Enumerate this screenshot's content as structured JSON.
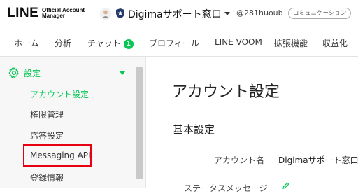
{
  "brand": {
    "logo": "LINE",
    "sub_line1": "Official Account",
    "sub_line2": "Manager"
  },
  "account": {
    "name": "Digimaサポート窓口",
    "id": "@281huoub",
    "plan_badge": "コミュニケーション"
  },
  "nav": [
    {
      "label": "ホーム"
    },
    {
      "label": "分析"
    },
    {
      "label": "チャット",
      "count": "1"
    },
    {
      "label": "プロフィール"
    },
    {
      "label": "LINE VOOM"
    },
    {
      "label": "拡張機能"
    },
    {
      "label": "収益化"
    }
  ],
  "sidebar": {
    "title": "設定",
    "items": [
      {
        "label": "アカウント設定",
        "active": true
      },
      {
        "label": "権限管理"
      },
      {
        "label": "応答設定"
      },
      {
        "label": "Messaging API"
      },
      {
        "label": "登録情報"
      }
    ]
  },
  "main": {
    "title": "アカウント設定",
    "section": "基本設定",
    "rows": [
      {
        "label": "アカウント名",
        "value": "Digimaサポート窓口"
      },
      {
        "label": "ステータスメッセージ",
        "value": ""
      }
    ]
  },
  "colors": {
    "accent": "#06c755",
    "highlight": "#e60012"
  },
  "icons": {
    "settings": "gear-icon",
    "avatar": "avatar-icon",
    "shield": "shield-icon",
    "edit": "pencil-icon"
  }
}
